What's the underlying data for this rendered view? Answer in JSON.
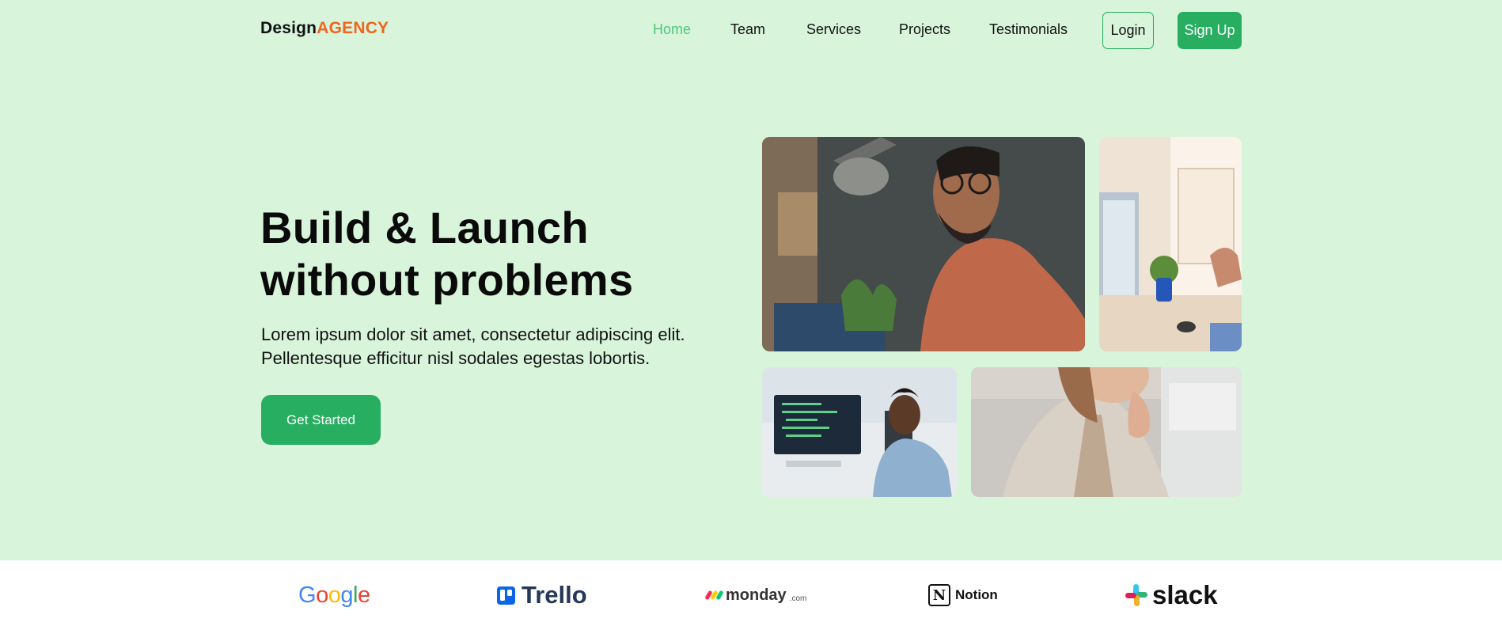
{
  "nav": {
    "logo_part1": "Design",
    "logo_part2": "AGENCY",
    "links": [
      {
        "label": "Home",
        "active": true
      },
      {
        "label": "Team"
      },
      {
        "label": "Services"
      },
      {
        "label": "Projects"
      },
      {
        "label": "Testimonials"
      }
    ],
    "login_label": "Login",
    "signup_label": "Sign Up"
  },
  "hero": {
    "headline_line1": "Build & Launch",
    "headline_line2": "without problems",
    "subtext": "Lorem ipsum dolor sit amet, consectetur adipiscing elit. Pellentesque efficitur nisl sodales egestas lobortis.",
    "cta_label": "Get Started"
  },
  "brands": {
    "google": "Google",
    "trello": "Trello",
    "monday": "monday",
    "monday_suffix": ".com",
    "notion": "Notion",
    "notion_mark": "N",
    "slack": "slack"
  },
  "colors": {
    "background": "#d8f5dc",
    "accent_green": "#27ae60",
    "active_link": "#4cc87a",
    "logo_orange": "#f0641e"
  }
}
